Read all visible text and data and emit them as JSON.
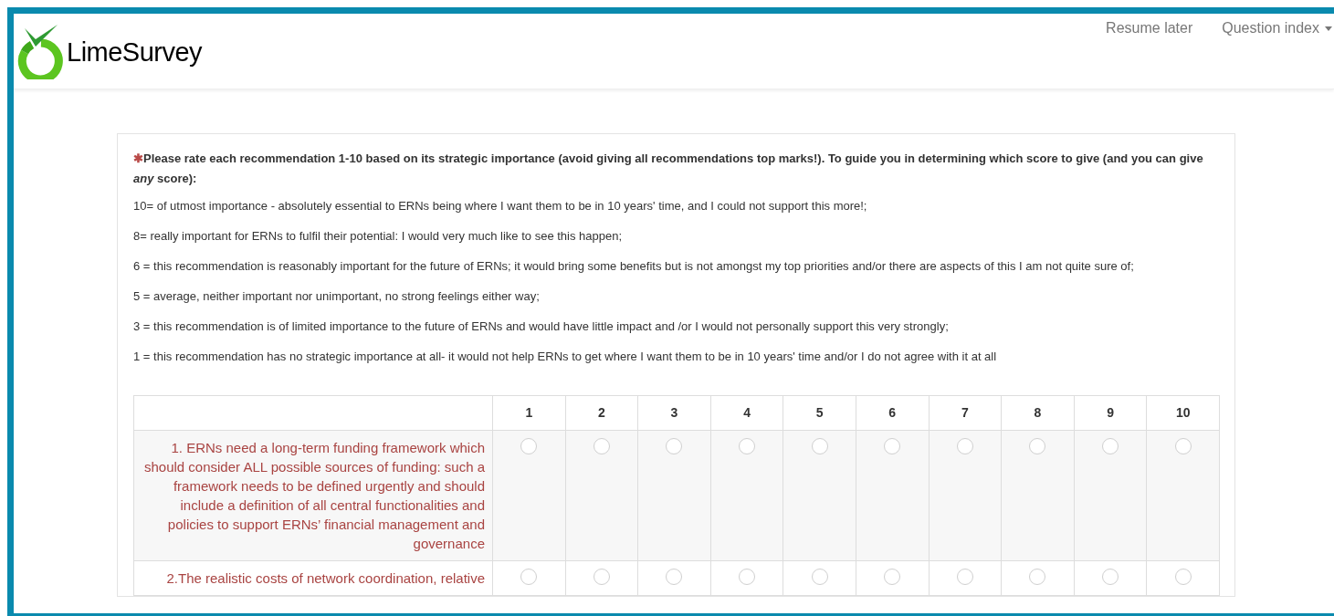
{
  "header": {
    "logo_text": "LimeSurvey",
    "nav": [
      {
        "label": "Resume later",
        "kind": "link"
      },
      {
        "label": "Question index",
        "kind": "dropdown"
      }
    ]
  },
  "question": {
    "mandatory_mark": "✱",
    "title": "Please rate each recommendation 1-10 based on its strategic importance (avoid giving all recommendations top marks!). To guide you in determining which score to give (and you can give *any* score):",
    "help": [
      "10= of utmost importance - absolutely essential to ERNs being where I want them to be in 10 years' time, and I could not support this more!;",
      "8= really important for ERNs to fulfil their potential: I would very much like to see this happen;",
      "6 = this recommendation is reasonably important for the future of ERNs; it would bring some benefits but is not amongst my top priorities and/or there are aspects of this I am not quite sure of;",
      "5 = average, neither important nor unimportant, no strong feelings either way;",
      "3 = this recommendation is of limited importance to the future of ERNs and would have little impact and /or I would not personally support this very strongly;",
      "1 = this recommendation has no strategic importance at all- it would not help ERNs to get where I want them to be in 10 years' time and/or I do not agree with it at all"
    ]
  },
  "table": {
    "columns": [
      "1",
      "2",
      "3",
      "4",
      "5",
      "6",
      "7",
      "8",
      "9",
      "10"
    ],
    "rows": [
      {
        "label": "1. ERNs need a long-term funding framework which should consider ALL possible sources of funding: such a framework needs to be defined urgently and should include a definition of all central functionalities and policies to support ERNs’ financial management and governance",
        "options": [
          {
            "selected": false
          },
          {
            "selected": false
          },
          {
            "selected": false
          },
          {
            "selected": false
          },
          {
            "selected": false
          },
          {
            "selected": false
          },
          {
            "selected": false
          },
          {
            "selected": false
          },
          {
            "selected": false
          },
          {
            "selected": false
          }
        ]
      },
      {
        "label": "2.The realistic costs of network coordination, relative",
        "options": [
          {
            "selected": false
          },
          {
            "selected": false
          },
          {
            "selected": false
          },
          {
            "selected": false
          },
          {
            "selected": false
          },
          {
            "selected": false
          },
          {
            "selected": false
          },
          {
            "selected": false
          },
          {
            "selected": false
          },
          {
            "selected": false
          }
        ]
      }
    ]
  }
}
